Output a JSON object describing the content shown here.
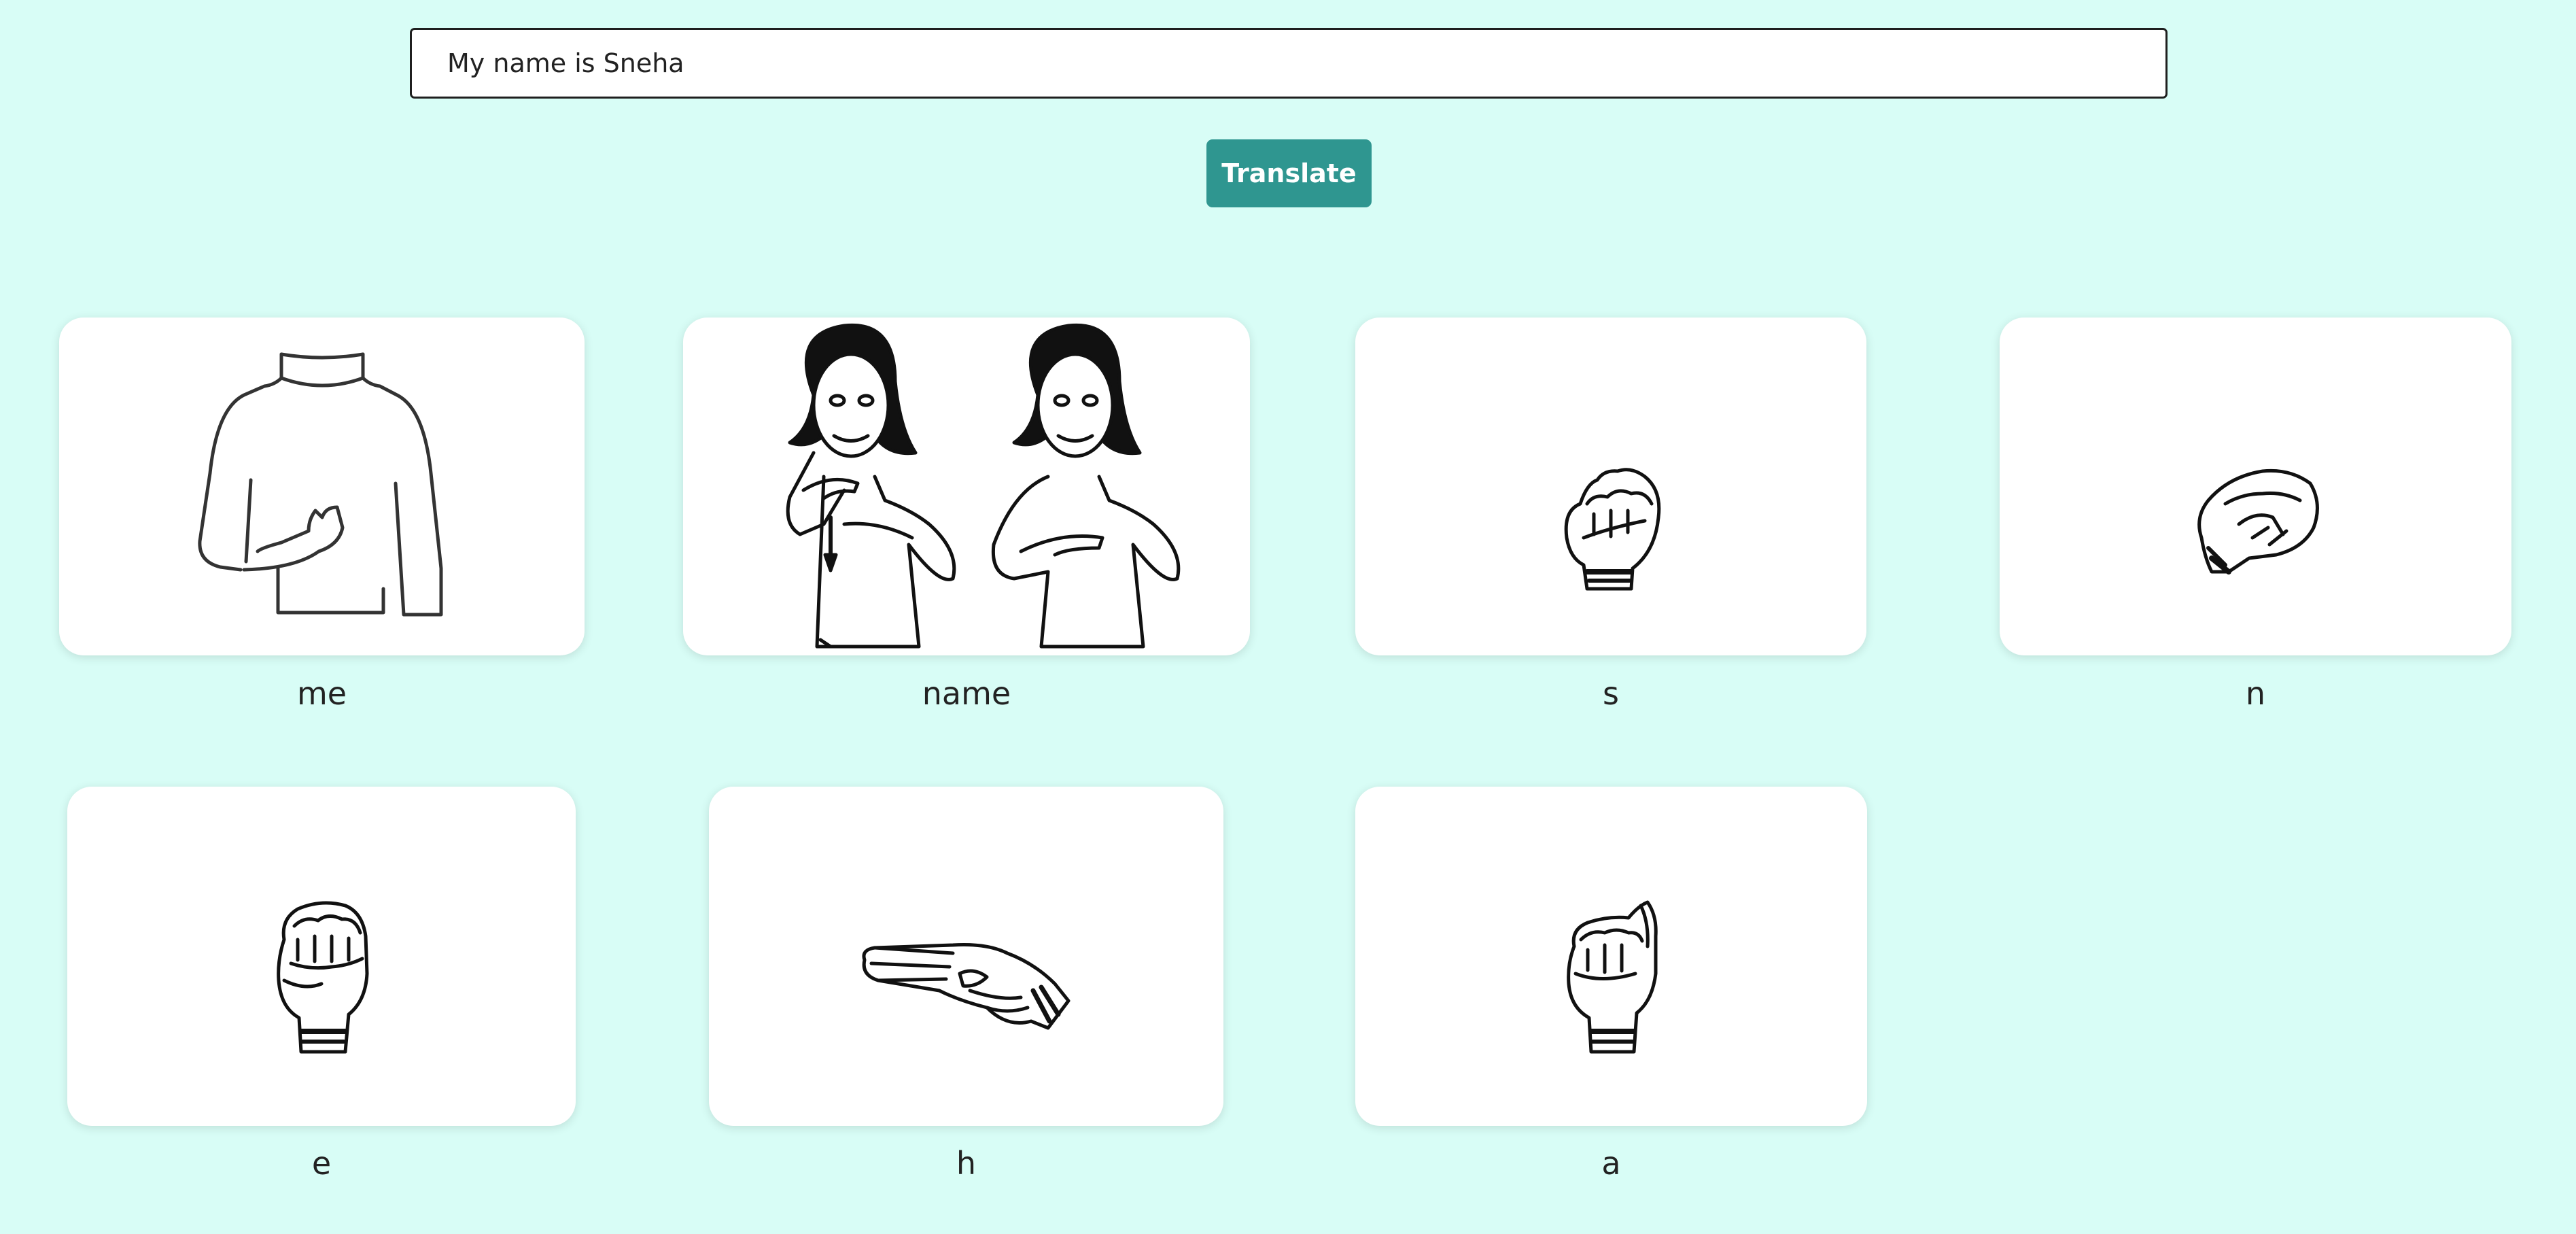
{
  "input": {
    "value": "My name is Sneha"
  },
  "translate_label": "Translate",
  "signs": [
    {
      "label": "me",
      "icon": "me-sign-icon"
    },
    {
      "label": "name",
      "icon": "name-sign-icon"
    },
    {
      "label": "s",
      "icon": "letter-s-hand-icon"
    },
    {
      "label": "n",
      "icon": "letter-n-hand-icon"
    },
    {
      "label": "e",
      "icon": "letter-e-hand-icon"
    },
    {
      "label": "h",
      "icon": "letter-h-hand-icon"
    },
    {
      "label": "a",
      "icon": "letter-a-hand-icon"
    }
  ]
}
